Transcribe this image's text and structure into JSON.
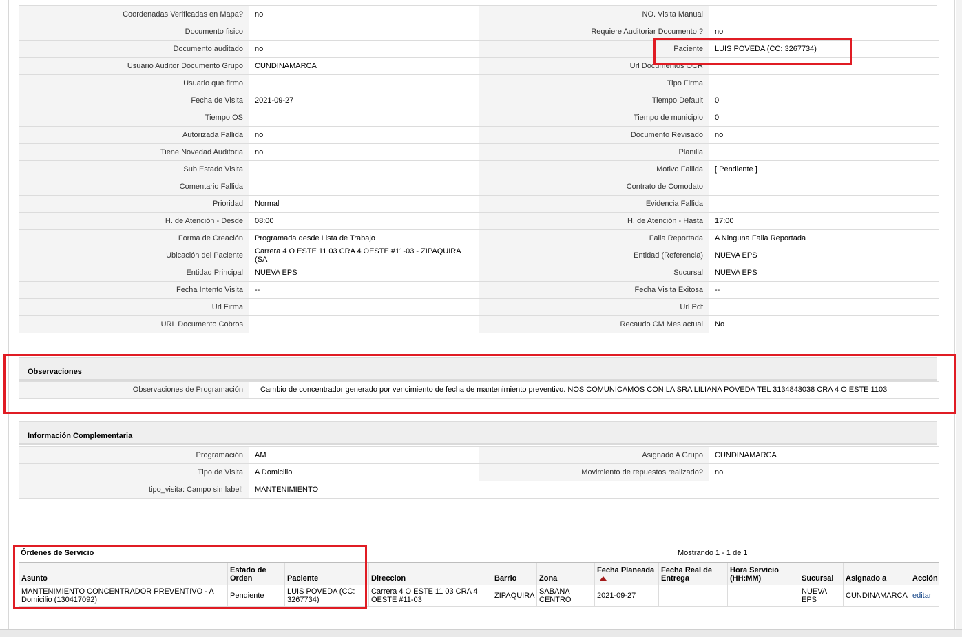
{
  "details": {
    "rows": [
      {
        "l1": "Coordenadas Verificadas en Mapa?",
        "v1": "no",
        "l2": "NO. Visita Manual",
        "v2": ""
      },
      {
        "l1": "Documento fisico",
        "v1": "",
        "l2": "Requiere Auditoriar Documento ?",
        "v2": "no"
      },
      {
        "l1": "Documento auditado",
        "v1": "no",
        "l2": "Paciente",
        "v2": "LUIS POVEDA (CC: 3267734)"
      },
      {
        "l1": "Usuario Auditor Documento Grupo",
        "v1": "CUNDINAMARCA",
        "l2": "Url Documentos OCR",
        "v2": ""
      },
      {
        "l1": "Usuario que firmo",
        "v1": "",
        "l2": "Tipo Firma",
        "v2": ""
      },
      {
        "l1": "Fecha de Visita",
        "v1": "2021-09-27",
        "l2": "Tiempo Default",
        "v2": "0"
      },
      {
        "l1": "Tiempo OS",
        "v1": "",
        "l2": "Tiempo de municipio",
        "v2": "0"
      },
      {
        "l1": "Autorizada Fallida",
        "v1": "no",
        "l2": "Documento Revisado",
        "v2": "no"
      },
      {
        "l1": "Tiene Novedad Auditoria",
        "v1": "no",
        "l2": "Planilla",
        "v2": ""
      },
      {
        "l1": "Sub Estado Visita",
        "v1": "",
        "l2": "Motivo Fallida",
        "v2": "[ Pendiente ]"
      },
      {
        "l1": "Comentario Fallida",
        "v1": "",
        "l2": "Contrato de Comodato",
        "v2": ""
      },
      {
        "l1": "Prioridad",
        "v1": "Normal",
        "l2": "Evidencia Fallida",
        "v2": ""
      },
      {
        "l1": "H. de Atención - Desde",
        "v1": "08:00",
        "l2": "H. de Atención - Hasta",
        "v2": "17:00"
      },
      {
        "l1": "Forma de Creación",
        "v1": "Programada desde Lista de Trabajo",
        "l2": "Falla Reportada",
        "v2": "A Ninguna Falla Reportada"
      },
      {
        "l1": "Ubicación del Paciente",
        "v1": "Carrera 4 O ESTE 11 03 CRA 4 OESTE #11-03 - ZIPAQUIRA (SA",
        "l2": "Entidad (Referencia)",
        "v2": "NUEVA EPS"
      },
      {
        "l1": "Entidad Principal",
        "v1": "NUEVA EPS",
        "l2": "Sucursal",
        "v2": "NUEVA EPS"
      },
      {
        "l1": "Fecha Intento Visita",
        "v1": "--",
        "l2": "Fecha Visita Exitosa",
        "v2": "--"
      },
      {
        "l1": "Url Firma",
        "v1": "",
        "l2": "Url Pdf",
        "v2": ""
      },
      {
        "l1": "URL Documento Cobros",
        "v1": "",
        "l2": "Recaudo CM Mes actual",
        "v2": "No"
      }
    ]
  },
  "observaciones": {
    "title": "Observaciones",
    "label": "Observaciones de Programación",
    "value": "Cambio de concentrador generado por vencimiento de fecha de mantenimiento preventivo. NOS COMUNICAMOS CON LA SRA LILIANA POVEDA TEL 3134843038 CRA 4 O ESTE 1103"
  },
  "complementaria": {
    "title": "Información Complementaria",
    "rows": [
      {
        "l1": "Programación",
        "v1": "AM",
        "l2": "Asignado A Grupo",
        "v2": "CUNDINAMARCA"
      },
      {
        "l1": "Tipo de Visita",
        "v1": "A Domicilio",
        "l2": "Movimiento de repuestos realizado?",
        "v2": "no"
      }
    ],
    "last_row": {
      "l1": "tipo_visita: Campo sin label!",
      "v1": "MANTENIMIENTO"
    }
  },
  "orders": {
    "title": "Órdenes de Servicio",
    "count_text": "Mostrando 1 - 1 de 1",
    "headers": [
      "Asunto",
      "Estado de Orden",
      "Paciente",
      "Direccion",
      "Barrio",
      "Zona",
      "Fecha Planeada",
      "Fecha Real de Entrega",
      "Hora Servicio (HH:MM)",
      "Sucursal",
      "Asignado a",
      "Acción"
    ],
    "rows": [
      [
        "MANTENIMIENTO CONCENTRADOR PREVENTIVO - A Domicilio (130417092)",
        "Pendiente",
        "LUIS POVEDA (CC: 3267734)",
        "Carrera 4 O ESTE 11 03 CRA 4 OESTE #11-03",
        "ZIPAQUIRA",
        "SABANA CENTRO",
        "2021-09-27",
        "",
        "",
        "NUEVA EPS",
        "CUNDINAMARCA",
        "editar"
      ]
    ]
  },
  "colors": {
    "highlight": "#e01c24",
    "label_bg": "#f4f4f4",
    "border": "#dcdcdc"
  }
}
